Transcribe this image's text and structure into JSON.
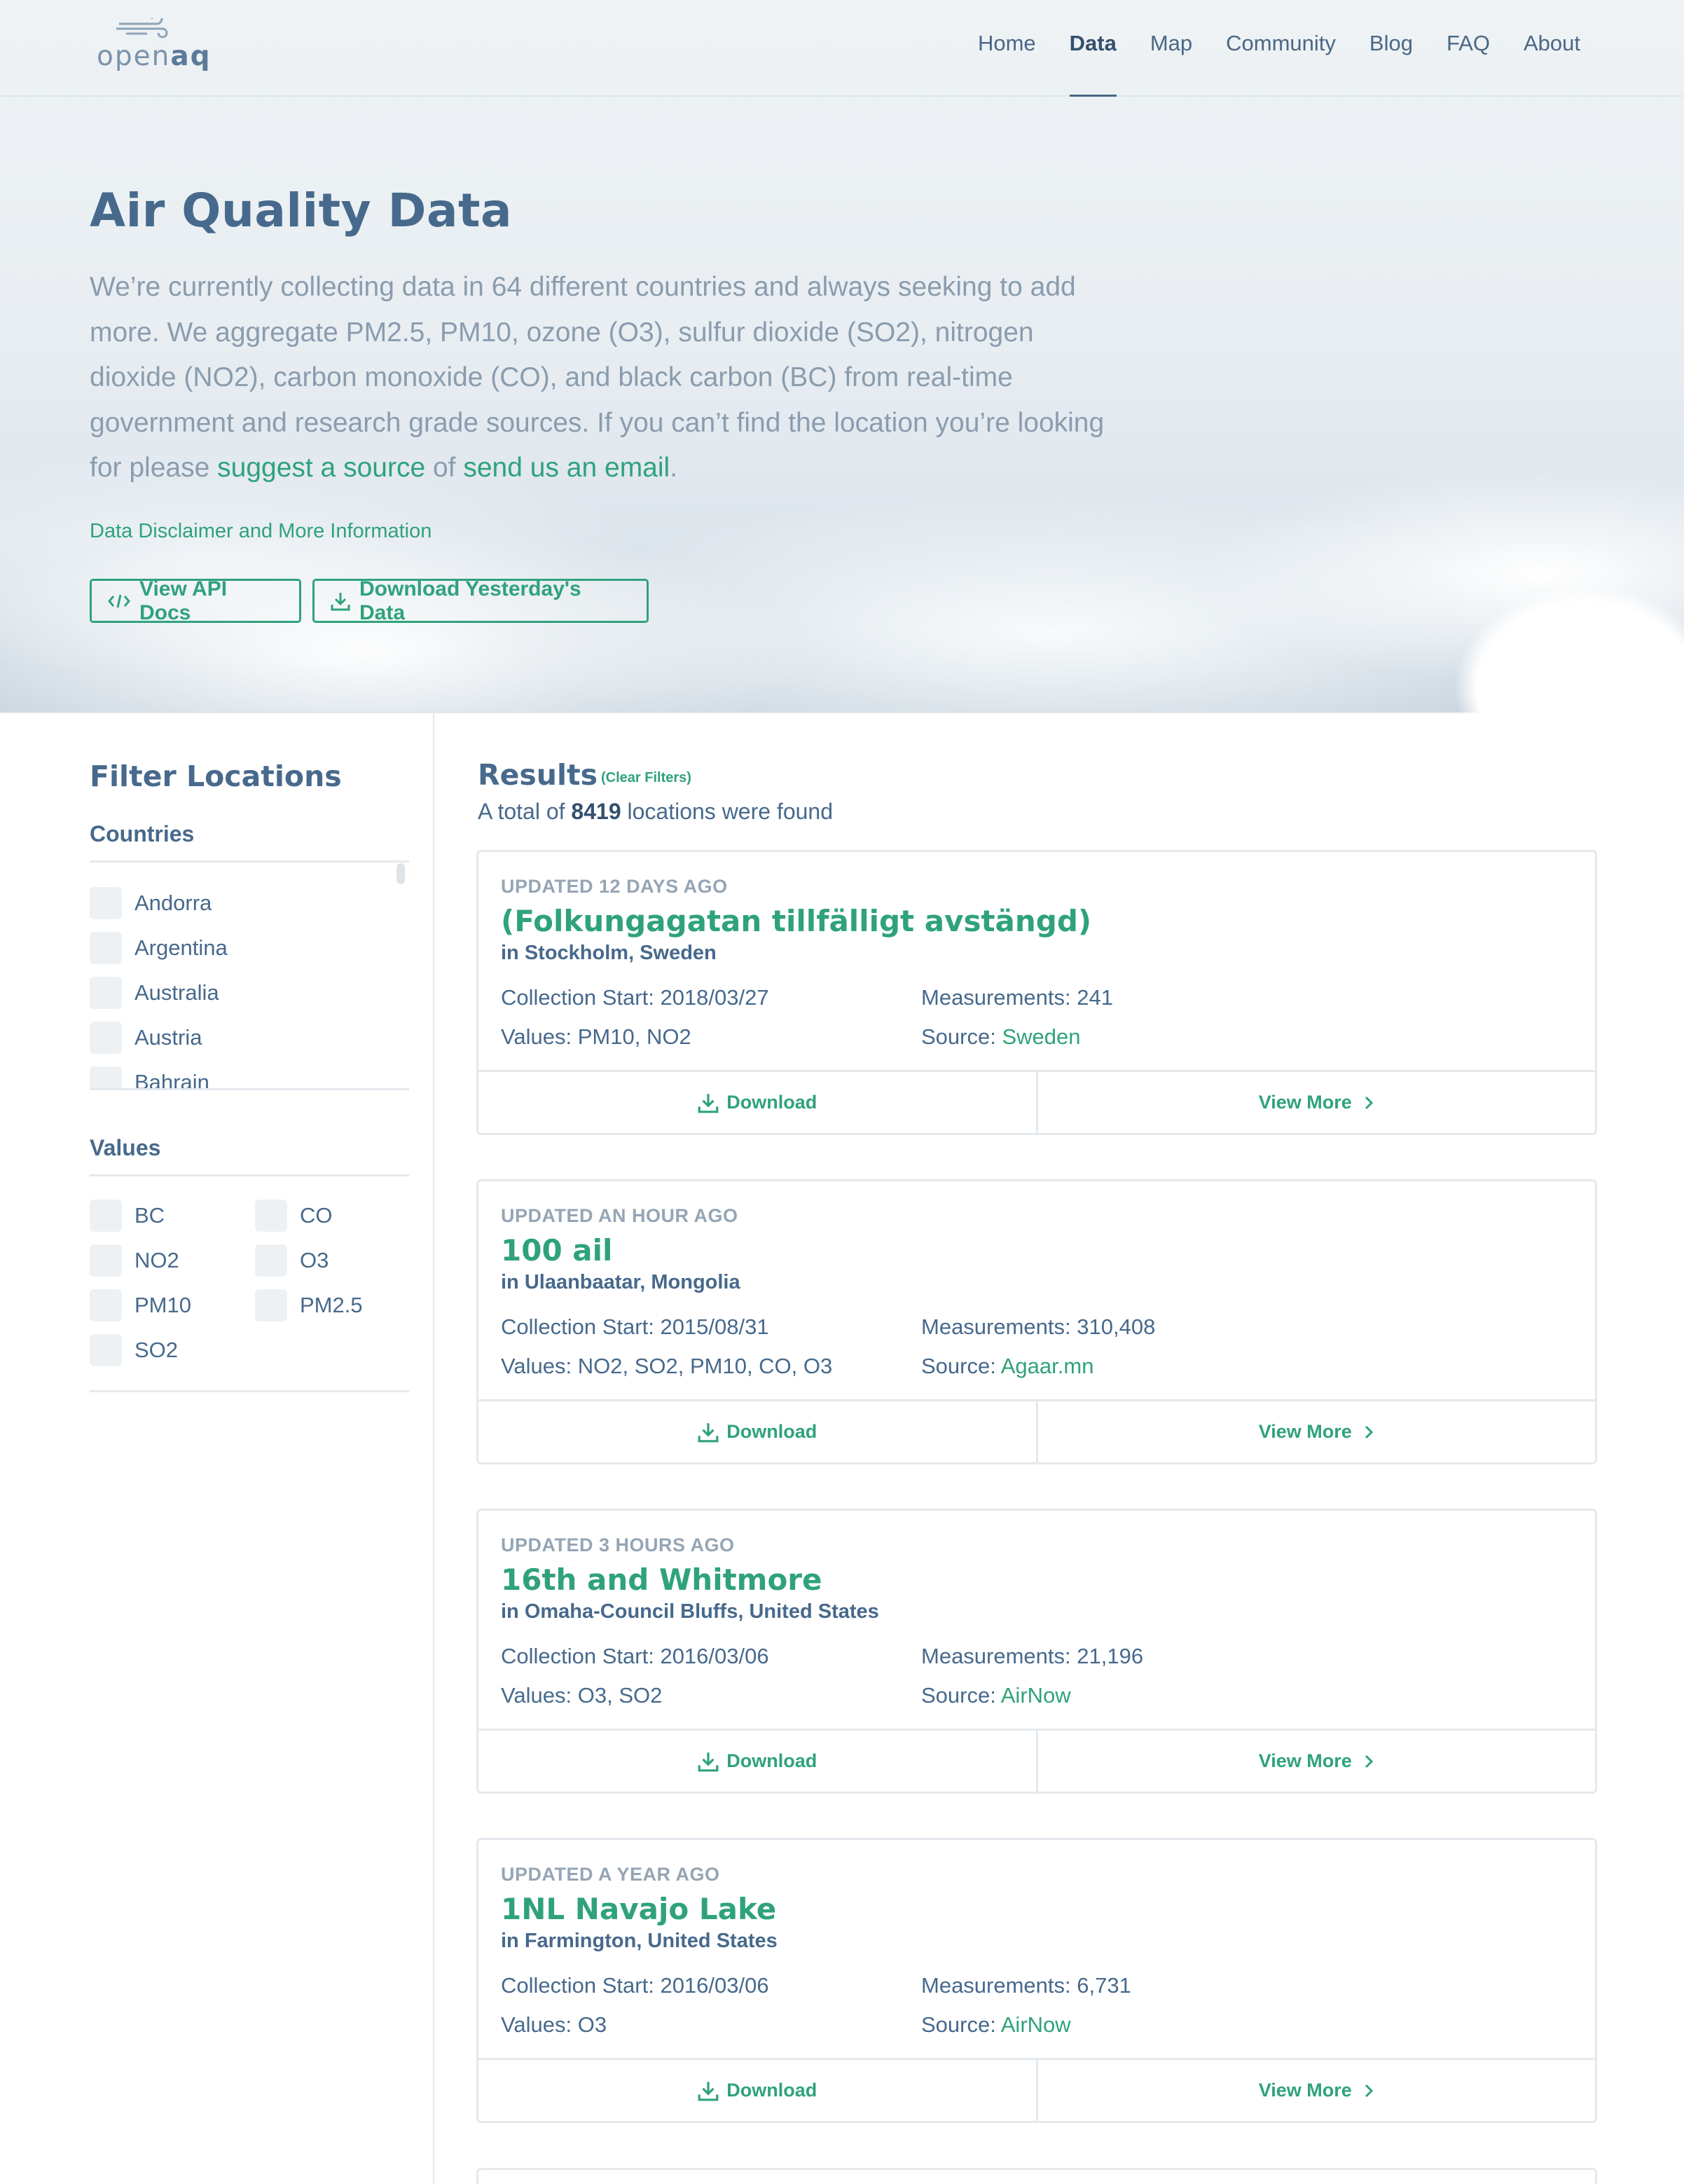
{
  "header": {
    "logo_text_light": "open",
    "logo_text_bold": "aq",
    "nav": [
      {
        "label": "Home",
        "active": false
      },
      {
        "label": "Data",
        "active": true
      },
      {
        "label": "Map",
        "active": false
      },
      {
        "label": "Community",
        "active": false
      },
      {
        "label": "Blog",
        "active": false
      },
      {
        "label": "FAQ",
        "active": false
      },
      {
        "label": "About",
        "active": false
      }
    ]
  },
  "hero": {
    "title": "Air Quality Data",
    "intro": "We’re currently collecting data in 64 different countries and always seeking to add more. We aggregate PM2.5, PM10, ozone (O3), sulfur dioxide (SO2), nitrogen dioxide (NO2), carbon monoxide (CO), and black carbon (BC) from real-time government and research grade sources. If you can’t find the location you’re looking for please",
    "suggest_link": "suggest a source",
    "connector": "of",
    "email_link": "send us an email",
    "end": ".",
    "disclaimer": "Data Disclaimer and More Information",
    "api_button": "View API Docs",
    "download_button": "Download Yesterday's Data"
  },
  "sidebar": {
    "title": "Filter Locations",
    "countries_label": "Countries",
    "countries": [
      "Andorra",
      "Argentina",
      "Australia",
      "Austria",
      "Bahrain"
    ],
    "values_label": "Values",
    "values": [
      "BC",
      "CO",
      "NO2",
      "O3",
      "PM10",
      "PM2.5",
      "SO2"
    ]
  },
  "results": {
    "title": "Results",
    "clear_filters": "(Clear Filters)",
    "total_prefix": "A total of",
    "total_count": "8419",
    "total_suffix": "locations were found",
    "collection_label": "Collection Start:",
    "measurements_label": "Measurements:",
    "values_label": "Values:",
    "source_label": "Source:",
    "download_label": "Download",
    "view_more_label": "View More",
    "items": [
      {
        "updated_prefix": "UPDATED",
        "updated_when": "12 DAYS AGO",
        "name": "(Folkungagatan tillfälligt avstängd)",
        "place": "in Stockholm, Sweden",
        "collection_start": "2018/03/27",
        "measurements": "241",
        "values": "PM10, NO2",
        "source": "Sweden"
      },
      {
        "updated_prefix": "UPDATED",
        "updated_when": "AN HOUR AGO",
        "name": "100 ail",
        "place": "in Ulaanbaatar, Mongolia",
        "collection_start": "2015/08/31",
        "measurements": "310,408",
        "values": "NO2, SO2, PM10, CO, O3",
        "source": "Agaar.mn"
      },
      {
        "updated_prefix": "UPDATED",
        "updated_when": "3 HOURS AGO",
        "name": "16th and Whitmore",
        "place": "in Omaha-Council Bluffs, United States",
        "collection_start": "2016/03/06",
        "measurements": "21,196",
        "values": "O3, SO2",
        "source": "AirNow"
      },
      {
        "updated_prefix": "UPDATED",
        "updated_when": "A YEAR AGO",
        "name": "1NL Navajo Lake",
        "place": "in Farmington, United States",
        "collection_start": "2016/03/06",
        "measurements": "6,731",
        "values": "O3",
        "source": "AirNow"
      }
    ]
  },
  "colors": {
    "brand_green": "#2fa27c",
    "heading_blue": "#47698c"
  }
}
